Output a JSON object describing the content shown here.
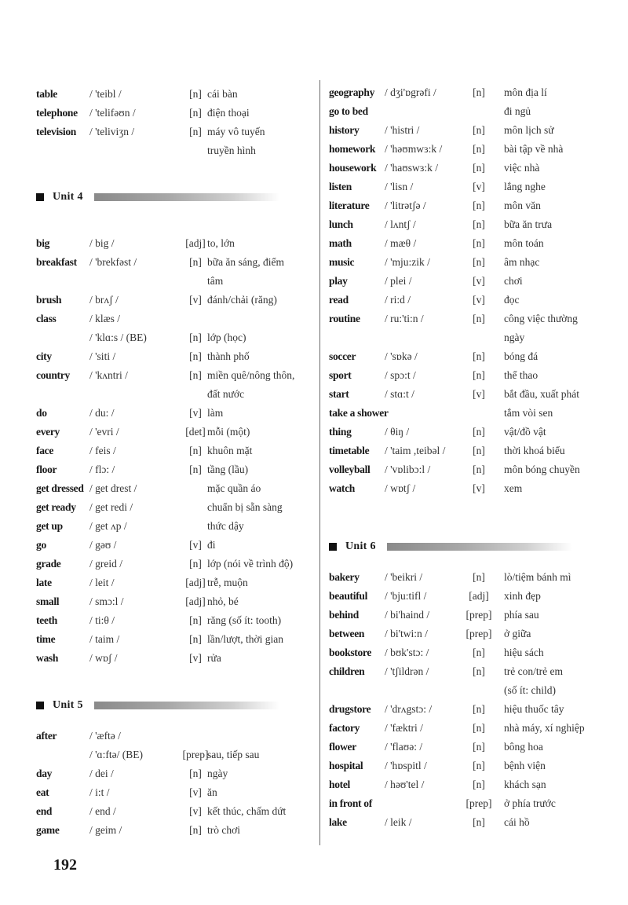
{
  "page_number": "192",
  "left_column": {
    "top_entries": [
      {
        "word": "table",
        "phonetic": "/ 'teibl /",
        "type": "[n]",
        "meaning": "cái bàn"
      },
      {
        "word": "telephone",
        "phonetic": "/ 'telifəʊn /",
        "type": "[n]",
        "meaning": "điện thoại"
      },
      {
        "word": "television",
        "phonetic": "/ 'teliviʒn /",
        "type": "[n]",
        "meaning": "máy vô tuyến"
      },
      {
        "word": "",
        "phonetic": "",
        "type": "",
        "meaning": "truyền hình"
      }
    ],
    "unit4": {
      "title": "Unit  4",
      "entries": [
        {
          "word": "big",
          "phonetic": "/ big /",
          "type": "[adj]",
          "meaning": "to, lớn"
        },
        {
          "word": "breakfast",
          "phonetic": "/ 'brekfəst /",
          "type": "[n]",
          "meaning": "bữa ăn sáng, điểm"
        },
        {
          "word": "",
          "phonetic": "",
          "type": "",
          "meaning": "tâm"
        },
        {
          "word": "brush",
          "phonetic": "/ brʌʃ /",
          "type": "[v]",
          "meaning": "đánh/chải (răng)"
        },
        {
          "word": "class",
          "phonetic": "/ klæs /",
          "type": "",
          "meaning": ""
        },
        {
          "word": "",
          "phonetic": "/ 'klɑ:s / (BE)",
          "type": "[n]",
          "meaning": "lớp (học)"
        },
        {
          "word": "city",
          "phonetic": "/ 'siti /",
          "type": "[n]",
          "meaning": "thành phố"
        },
        {
          "word": "country",
          "phonetic": "/ 'kʌntri /",
          "type": "[n]",
          "meaning": "miền quê/nông thôn,"
        },
        {
          "word": "",
          "phonetic": "",
          "type": "",
          "meaning": "đất nước"
        },
        {
          "word": "do",
          "phonetic": "/ du: /",
          "type": "[v]",
          "meaning": "làm"
        },
        {
          "word": "every",
          "phonetic": "/ 'evri /",
          "type": "[det]",
          "meaning": "mỗi (một)"
        },
        {
          "word": "face",
          "phonetic": "/ feis /",
          "type": "[n]",
          "meaning": "khuôn mặt"
        },
        {
          "word": "floor",
          "phonetic": "/ flɔ: /",
          "type": "[n]",
          "meaning": "tầng (lầu)"
        },
        {
          "word": "get dressed",
          "phonetic": "/ get drest /",
          "type": "",
          "meaning": "mặc quần áo"
        },
        {
          "word": "get ready",
          "phonetic": "/ get redi /",
          "type": "",
          "meaning": "chuẩn bị sẵn sàng"
        },
        {
          "word": "get up",
          "phonetic": "/ get ʌp /",
          "type": "",
          "meaning": "thức dậy"
        },
        {
          "word": "go",
          "phonetic": "/ gəʊ /",
          "type": "[v]",
          "meaning": "đi"
        },
        {
          "word": "grade",
          "phonetic": "/ greid /",
          "type": "[n]",
          "meaning": "lớp (nói về trình độ)"
        },
        {
          "word": "late",
          "phonetic": "/ leit /",
          "type": "[adj]",
          "meaning": "trễ, muộn"
        },
        {
          "word": "small",
          "phonetic": "/ smɔ:l /",
          "type": "[adj]",
          "meaning": "nhỏ, bé"
        },
        {
          "word": "teeth",
          "phonetic": "/ ti:θ /",
          "type": "[n]",
          "meaning": "răng (số ít: tooth)"
        },
        {
          "word": "time",
          "phonetic": "/ taim /",
          "type": "[n]",
          "meaning": "lần/lượt, thời gian"
        },
        {
          "word": "wash",
          "phonetic": "/ wɒʃ /",
          "type": "[v]",
          "meaning": "rửa"
        }
      ]
    },
    "unit5": {
      "title": "Unit  5",
      "entries": [
        {
          "word": "after",
          "phonetic": "/ 'æftə /",
          "type": "",
          "meaning": ""
        },
        {
          "word": "",
          "phonetic": "/ 'ɑ:ftə/ (BE)",
          "type": "[prep]",
          "meaning": "sau, tiếp sau"
        },
        {
          "word": "day",
          "phonetic": "/ dei /",
          "type": "[n]",
          "meaning": "ngày"
        },
        {
          "word": "eat",
          "phonetic": "/ i:t /",
          "type": "[v]",
          "meaning": "ăn"
        },
        {
          "word": "end",
          "phonetic": "/ end /",
          "type": "[v]",
          "meaning": "kết thúc, chấm dứt"
        },
        {
          "word": "game",
          "phonetic": "/ geim /",
          "type": "[n]",
          "meaning": "trò chơi"
        }
      ]
    }
  },
  "right_column": {
    "top_entries": [
      {
        "word": "geography",
        "phonetic": "/ dʒi'ɒgrəfi /",
        "type": "[n]",
        "meaning": "môn địa lí"
      },
      {
        "word": "go to bed",
        "phonetic": "",
        "type": "",
        "meaning": "đi ngủ"
      },
      {
        "word": "history",
        "phonetic": "/ 'histri /",
        "type": "[n]",
        "meaning": "môn lịch sử"
      },
      {
        "word": "homework",
        "phonetic": "/ 'həʊmwɜ:k /",
        "type": "[n]",
        "meaning": "bài tập về nhà"
      },
      {
        "word": "housework",
        "phonetic": "/ 'haʊswɜ:k /",
        "type": "[n]",
        "meaning": "việc nhà"
      },
      {
        "word": "listen",
        "phonetic": "/ 'lisn /",
        "type": "[v]",
        "meaning": "lắng nghe"
      },
      {
        "word": "literature",
        "phonetic": "/ 'litrətʃə /",
        "type": "[n]",
        "meaning": "môn văn"
      },
      {
        "word": "lunch",
        "phonetic": "/ lʌntʃ /",
        "type": "[n]",
        "meaning": "bữa ăn trưa"
      },
      {
        "word": "math",
        "phonetic": "/ mæθ /",
        "type": "[n]",
        "meaning": "môn toán"
      },
      {
        "word": "music",
        "phonetic": "/ 'mju:zik /",
        "type": "[n]",
        "meaning": "âm nhạc"
      },
      {
        "word": "play",
        "phonetic": "/ plei /",
        "type": "[v]",
        "meaning": "chơi"
      },
      {
        "word": "read",
        "phonetic": "/ ri:d /",
        "type": "[v]",
        "meaning": "đọc"
      },
      {
        "word": "routine",
        "phonetic": "/ ru:'ti:n /",
        "type": "[n]",
        "meaning": "công việc thường"
      },
      {
        "word": "",
        "phonetic": "",
        "type": "",
        "meaning": "ngày"
      },
      {
        "word": "soccer",
        "phonetic": "/ 'sɒkə /",
        "type": "[n]",
        "meaning": "bóng đá"
      },
      {
        "word": "sport",
        "phonetic": "/ spɔ:t /",
        "type": "[n]",
        "meaning": "thể thao"
      },
      {
        "word": "start",
        "phonetic": "/ stɑ:t /",
        "type": "[v]",
        "meaning": "bắt đầu, xuất phát"
      },
      {
        "word": "take a shower",
        "phonetic": "",
        "type": "",
        "meaning": "tắm vòi sen"
      },
      {
        "word": "thing",
        "phonetic": "/ θiŋ /",
        "type": "[n]",
        "meaning": "vật/đồ vật"
      },
      {
        "word": "timetable",
        "phonetic": "/ 'taim ,teibəl /",
        "type": "[n]",
        "meaning": "thời khoá biểu"
      },
      {
        "word": "volleyball",
        "phonetic": "/ 'vɒlibɔ:l /",
        "type": "[n]",
        "meaning": "môn bóng chuyền"
      },
      {
        "word": "watch",
        "phonetic": "/ wɒtʃ /",
        "type": "[v]",
        "meaning": "xem"
      }
    ],
    "unit6": {
      "title": "Unit  6",
      "entries": [
        {
          "word": "bakery",
          "phonetic": "/ 'beikri /",
          "type": "[n]",
          "meaning": "lò/tiệm bánh mì"
        },
        {
          "word": "beautiful",
          "phonetic": "/ 'bju:tifl /",
          "type": "[adj]",
          "meaning": "xinh đẹp"
        },
        {
          "word": "behind",
          "phonetic": "/ bi'haind /",
          "type": "[prep]",
          "meaning": "phía sau"
        },
        {
          "word": "between",
          "phonetic": "/ bi'twi:n /",
          "type": "[prep]",
          "meaning": "ở giữa"
        },
        {
          "word": "bookstore",
          "phonetic": "/ bʊk'stɔ: /",
          "type": "[n]",
          "meaning": "hiệu sách"
        },
        {
          "word": "children",
          "phonetic": "/ 'tʃildrən /",
          "type": "[n]",
          "meaning": "trẻ con/trẻ em"
        },
        {
          "word": "",
          "phonetic": "",
          "type": "",
          "meaning": "(số ít: child)"
        },
        {
          "word": "drugstore",
          "phonetic": "/ 'drʌgstɔ: /",
          "type": "[n]",
          "meaning": "hiệu thuốc tây"
        },
        {
          "word": "factory",
          "phonetic": "/ 'fæktri /",
          "type": "[n]",
          "meaning": "nhà máy, xí nghiệp"
        },
        {
          "word": "flower",
          "phonetic": "/ 'flaʊə: /",
          "type": "[n]",
          "meaning": "bông hoa"
        },
        {
          "word": "hospital",
          "phonetic": "/ 'hɒspitl /",
          "type": "[n]",
          "meaning": "bệnh viện"
        },
        {
          "word": "hotel",
          "phonetic": "/ həʊ'tel /",
          "type": "[n]",
          "meaning": "khách sạn"
        },
        {
          "word": "in front of",
          "phonetic": "",
          "type": "[prep]",
          "meaning": "ở phía trước"
        },
        {
          "word": "lake",
          "phonetic": "/ leik /",
          "type": "[n]",
          "meaning": "cái hồ"
        }
      ]
    }
  }
}
